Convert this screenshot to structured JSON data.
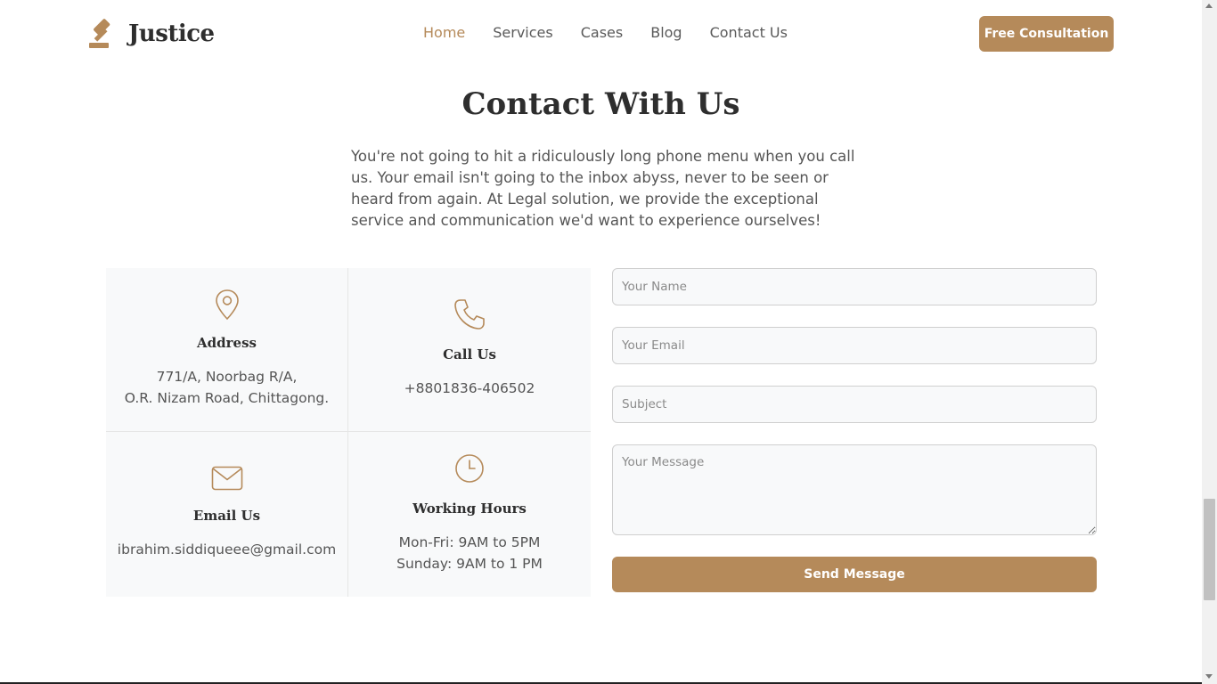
{
  "brand": {
    "name": "Justice",
    "accent": "#b58a5a"
  },
  "nav": {
    "items": [
      {
        "label": "Home",
        "active": true
      },
      {
        "label": "Services",
        "active": false
      },
      {
        "label": "Cases",
        "active": false
      },
      {
        "label": "Blog",
        "active": false
      },
      {
        "label": "Contact Us",
        "active": false
      }
    ],
    "cta_label": "Free Consultation"
  },
  "contact": {
    "heading": "Contact With Us",
    "intro": "You're not going to hit a ridiculously long phone menu when you call us. Your email isn't going to the inbox abyss, never to be seen or heard from again. At Legal solution, we provide the exceptional service and communication we'd want to experience ourselves!",
    "info": {
      "address": {
        "icon": "map-pin-icon",
        "title": "Address",
        "line1": "771/A, Noorbag R/A,",
        "line2": "O.R. Nizam Road, Chittagong."
      },
      "call": {
        "icon": "phone-icon",
        "title": "Call Us",
        "line1": "+8801836-406502"
      },
      "email": {
        "icon": "envelope-icon",
        "title": "Email Us",
        "line1": "ibrahim.siddiqueee@gmail.com"
      },
      "hours": {
        "icon": "clock-icon",
        "title": "Working Hours",
        "line1": "Mon-Fri: 9AM to 5PM",
        "line2": "Sunday: 9AM to 1 PM"
      }
    },
    "form": {
      "name_placeholder": "Your Name",
      "email_placeholder": "Your Email",
      "subject_placeholder": "Subject",
      "message_placeholder": "Your Message",
      "submit_label": "Send Message"
    }
  }
}
